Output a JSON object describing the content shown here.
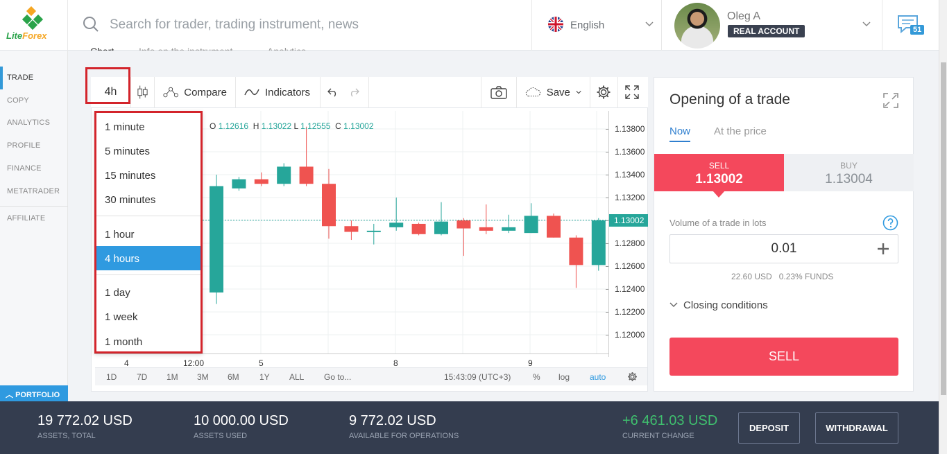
{
  "logo": {
    "text_a": "Lite",
    "text_b": "Forex"
  },
  "search": {
    "placeholder": "Search for trader, trading instrument, news"
  },
  "language": {
    "label": "English"
  },
  "user": {
    "name": "Oleg A",
    "account_type": "REAL ACCOUNT"
  },
  "notifications": {
    "count": "51"
  },
  "sidebar": {
    "items": [
      {
        "label": "TRADE",
        "active": true
      },
      {
        "label": "COPY"
      },
      {
        "label": "ANALYTICS"
      },
      {
        "label": "PROFILE"
      },
      {
        "label": "FINANCE"
      },
      {
        "label": "METATRADER"
      },
      {
        "label": "AFFILIATE"
      }
    ],
    "portfolio": "PORTFOLIO"
  },
  "tabs": [
    "Chart",
    "Info on the instrument",
    "Analytics"
  ],
  "toolbar": {
    "interval": "4h",
    "compare": "Compare",
    "indicators": "Indicators",
    "save": "Save"
  },
  "timeframes": [
    "1 minute",
    "5 minutes",
    "15 minutes",
    "30 minutes",
    "1 hour",
    "4 hours",
    "1 day",
    "1 week",
    "1 month"
  ],
  "timeframe_selected": "4 hours",
  "ohlc": {
    "o_label": "O",
    "o": "1.12616",
    "h_label": "H",
    "h": "1.13022",
    "l_label": "L",
    "l": "1.12555",
    "c_label": "C",
    "c": "1.13002"
  },
  "chart_data": {
    "type": "candlestick",
    "price_axis": [
      "1.13800",
      "1.13600",
      "1.13400",
      "1.13200",
      "1.13000",
      "1.12800",
      "1.12600",
      "1.12400",
      "1.12200",
      "1.12000"
    ],
    "ylim": [
      1.1195,
      1.1395
    ],
    "last_price": "1.13002",
    "x_labels": [
      "4",
      "12:00",
      "5",
      "8",
      "9"
    ],
    "candles": [
      {
        "o": 1.1237,
        "h": 1.134,
        "l": 1.1227,
        "c": 1.133
      },
      {
        "o": 1.1328,
        "h": 1.1338,
        "l": 1.1326,
        "c": 1.1336
      },
      {
        "o": 1.1336,
        "h": 1.1342,
        "l": 1.133,
        "c": 1.1332
      },
      {
        "o": 1.1332,
        "h": 1.135,
        "l": 1.133,
        "c": 1.1347
      },
      {
        "o": 1.1347,
        "h": 1.1382,
        "l": 1.133,
        "c": 1.1332
      },
      {
        "o": 1.1332,
        "h": 1.1345,
        "l": 1.1284,
        "c": 1.1295
      },
      {
        "o": 1.1295,
        "h": 1.13,
        "l": 1.1283,
        "c": 1.129
      },
      {
        "o": 1.129,
        "h": 1.1297,
        "l": 1.1279,
        "c": 1.1291
      },
      {
        "o": 1.1294,
        "h": 1.132,
        "l": 1.1291,
        "c": 1.1298
      },
      {
        "o": 1.1297,
        "h": 1.1298,
        "l": 1.1287,
        "c": 1.1288
      },
      {
        "o": 1.1288,
        "h": 1.1316,
        "l": 1.1287,
        "c": 1.1299
      },
      {
        "o": 1.13,
        "h": 1.1302,
        "l": 1.1269,
        "c": 1.1293
      },
      {
        "o": 1.1294,
        "h": 1.1314,
        "l": 1.1288,
        "c": 1.1291
      },
      {
        "o": 1.1291,
        "h": 1.1305,
        "l": 1.1289,
        "c": 1.1294
      },
      {
        "o": 1.1289,
        "h": 1.1315,
        "l": 1.1289,
        "c": 1.1304
      },
      {
        "o": 1.1304,
        "h": 1.1306,
        "l": 1.1285,
        "c": 1.1285
      },
      {
        "o": 1.1285,
        "h": 1.1287,
        "l": 1.1241,
        "c": 1.1261
      },
      {
        "o": 1.1261,
        "h": 1.1302,
        "l": 1.1256,
        "c": 1.13
      }
    ]
  },
  "range_bar": {
    "ranges": [
      "1D",
      "7D",
      "1M",
      "3M",
      "6M",
      "1Y",
      "ALL"
    ],
    "goto": "Go to...",
    "time": "15:43:09 (UTC+3)",
    "percent": "%",
    "log": "log",
    "auto": "auto"
  },
  "trade": {
    "title": "Opening of a trade",
    "tab_now": "Now",
    "tab_price": "At the price",
    "sell_label": "SELL",
    "sell_price": "1.13002",
    "buy_label": "BUY",
    "buy_price": "1.13004",
    "volume_label": "Volume of a trade in lots",
    "volume_value": "0.01",
    "funds": "22.60 USD   0.23% FUNDS",
    "closing": "Closing conditions",
    "sell_button": "SELL"
  },
  "footer": {
    "assets_total": "19 772.02 USD",
    "assets_total_label": "ASSETS, TOTAL",
    "assets_used": "10 000.00 USD",
    "assets_used_label": "ASSETS USED",
    "available": "9 772.02 USD",
    "available_label": "AVAILABLE FOR OPERATIONS",
    "change": "+6 461.03 USD",
    "change_label": "CURRENT CHANGE",
    "deposit": "DEPOSIT",
    "withdrawal": "WITHDRAWAL"
  },
  "colors": {
    "accent": "#2f9ae0",
    "sell": "#f4485c",
    "up": "#26a69a",
    "down": "#ef5350",
    "highlight": "#d3242b",
    "footer_bg": "#343d4f",
    "positive": "#3fbf6e"
  }
}
